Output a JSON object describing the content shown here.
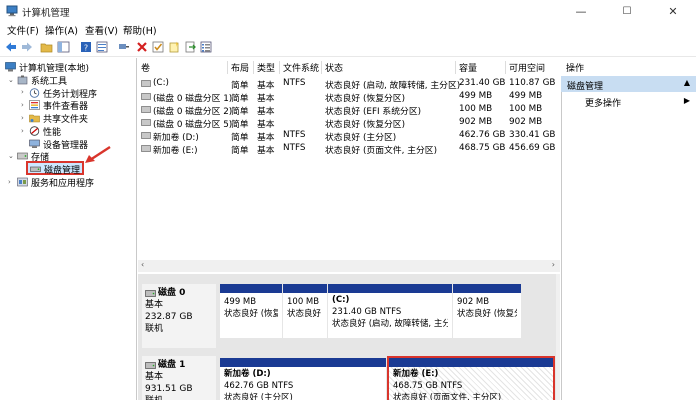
{
  "window": {
    "title": "计算机管理",
    "minimize": "—",
    "maximize": "☐",
    "close": "✕"
  },
  "menu": [
    "文件(F)",
    "操作(A)",
    "查看(V)",
    "帮助(H)"
  ],
  "tree": {
    "root": "计算机管理(本地)",
    "system_tools": "系统工具",
    "task_scheduler": "任务计划程序",
    "event_viewer": "事件查看器",
    "shared_folders": "共享文件夹",
    "performance": "性能",
    "device_manager": "设备管理器",
    "storage": "存储",
    "disk_management": "磁盘管理",
    "services_apps": "服务和应用程序"
  },
  "table": {
    "headers": [
      "卷",
      "布局",
      "类型",
      "文件系统",
      "状态",
      "容量",
      "可用空间"
    ],
    "rows": [
      [
        "(C:)",
        "简单",
        "基本",
        "NTFS",
        "状态良好 (启动, 故障转储, 主分区)",
        "231.40 GB",
        "110.87 GB"
      ],
      [
        "(磁盘 0 磁盘分区 1)",
        "简单",
        "基本",
        "",
        "状态良好 (恢复分区)",
        "499 MB",
        "499 MB"
      ],
      [
        "(磁盘 0 磁盘分区 2)",
        "简单",
        "基本",
        "",
        "状态良好 (EFI 系统分区)",
        "100 MB",
        "100 MB"
      ],
      [
        "(磁盘 0 磁盘分区 5)",
        "简单",
        "基本",
        "",
        "状态良好 (恢复分区)",
        "902 MB",
        "902 MB"
      ],
      [
        "新加卷 (D:)",
        "简单",
        "基本",
        "NTFS",
        "状态良好 (主分区)",
        "462.76 GB",
        "330.41 GB"
      ],
      [
        "新加卷 (E:)",
        "简单",
        "基本",
        "NTFS",
        "状态良好 (页面文件, 主分区)",
        "468.75 GB",
        "456.69 GB"
      ]
    ]
  },
  "disks": [
    {
      "name": "磁盘 0",
      "type": "基本",
      "size": "232.87 GB",
      "status": "联机",
      "partitions": [
        {
          "title": "",
          "size": "499 MB",
          "status": "状态良好 (恢复分区)"
        },
        {
          "title": "",
          "size": "100 MB",
          "status": "状态良好 (EF"
        },
        {
          "title": "(C:)",
          "size": "231.40 GB NTFS",
          "status": "状态良好 (启动, 故障转储, 主分区"
        },
        {
          "title": "",
          "size": "902 MB",
          "status": "状态良好 (恢复分区"
        }
      ]
    },
    {
      "name": "磁盘 1",
      "type": "基本",
      "size": "931.51 GB",
      "status": "联机",
      "partitions": [
        {
          "title": "新加卷 (D:)",
          "size": "462.76 GB NTFS",
          "status": "状态良好 (主分区)"
        },
        {
          "title": "新加卷 (E:)",
          "size": "468.75 GB NTFS",
          "status": "状态良好 (页面文件, 主分区)"
        }
      ]
    }
  ],
  "actions": {
    "header": "操作",
    "section": "磁盘管理",
    "more": "更多操作"
  },
  "colors": {
    "partition_bar": "#1a3a93",
    "highlight_border": "#d9352c",
    "selection": "#cde8ff",
    "actions_section": "#c8ddf2"
  }
}
